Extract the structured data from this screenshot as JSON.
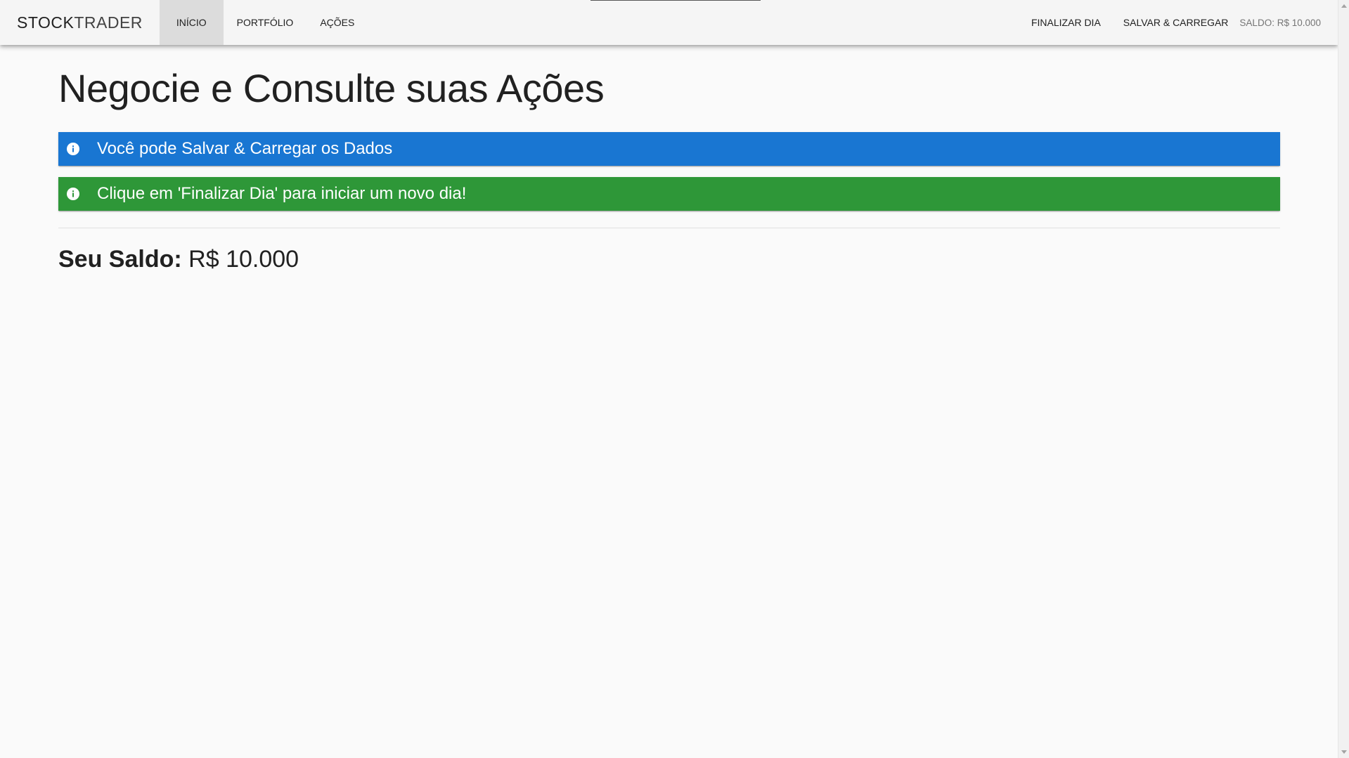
{
  "toolbar": {
    "brand_part1": "STOCK",
    "brand_part2": "TRADER",
    "nav": [
      {
        "label": "Início",
        "active": true
      },
      {
        "label": "Portfólio",
        "active": false
      },
      {
        "label": "Ações",
        "active": false
      }
    ],
    "end_day_label": "Finalizar Dia",
    "save_load_label": "Salvar & Carregar",
    "balance_label": "SALDO: R$ 10.000"
  },
  "main": {
    "title": "Negocie e Consulte suas Ações",
    "alerts": [
      {
        "type": "info",
        "text": "Você pode Salvar & Carregar os Dados",
        "icon": "info-icon"
      },
      {
        "type": "success",
        "text": "Clique em 'Finalizar Dia' para iniciar um novo dia!",
        "icon": "info-icon"
      }
    ],
    "balance_label": "Seu Saldo:",
    "balance_value": "R$ 10.000"
  },
  "colors": {
    "info": "#1976d2",
    "success": "#2e9738",
    "toolbar_bg": "#f5f5f5",
    "active_tab_bg": "#dcdcdc"
  }
}
